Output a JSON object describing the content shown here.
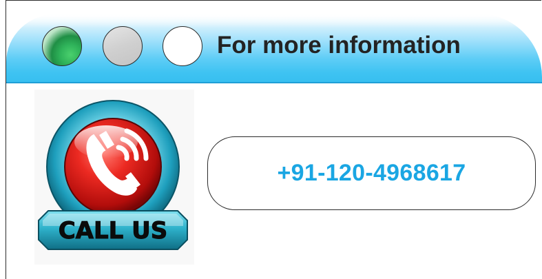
{
  "header": {
    "title": "For more information",
    "window_buttons": [
      {
        "name": "green",
        "color": "#2fb35a"
      },
      {
        "name": "gray",
        "color": "#cfcfcf"
      },
      {
        "name": "white",
        "color": "#ffffff"
      }
    ]
  },
  "call_badge": {
    "label": "CALL US",
    "icon": "phone-handset-ringing-icon",
    "colors": {
      "button": "#e8231f",
      "ring": "#1fa6c4",
      "plate": "#1aa0b8"
    }
  },
  "contact": {
    "phone": "+91-120-4968617",
    "phone_color": "#1aa6e3"
  }
}
